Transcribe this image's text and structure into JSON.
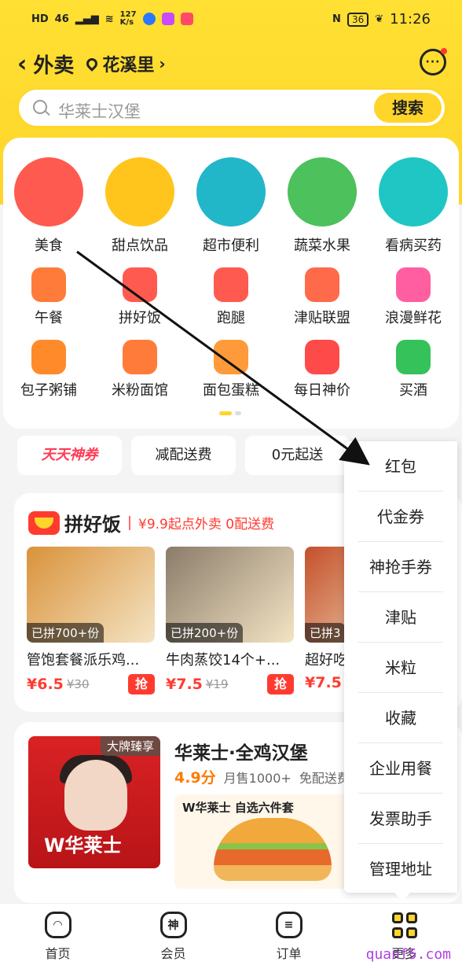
{
  "status_bar": {
    "left_text": "HD",
    "network": "46",
    "speed": "127\nK/s",
    "time": "11:26",
    "battery": "36"
  },
  "header": {
    "back_icon": "chevron-left-icon",
    "title": "外卖",
    "location": "花溪里",
    "message_icon": "chat-bubble-icon"
  },
  "search": {
    "placeholder": "华莱士汉堡",
    "button": "搜索"
  },
  "categories_main": [
    {
      "label": "美食",
      "icon": "food-icon",
      "color": "#ff5a4f"
    },
    {
      "label": "甜点饮品",
      "icon": "dessert-icon",
      "color": "#ffc51c"
    },
    {
      "label": "超市便利",
      "icon": "basket-icon",
      "color": "#22b6c9"
    },
    {
      "label": "蔬菜水果",
      "icon": "carrot-icon",
      "color": "#4cc15c"
    },
    {
      "label": "看病买药",
      "icon": "medicine-box-icon",
      "color": "#1fc6c4"
    }
  ],
  "categories_row2": [
    {
      "label": "午餐",
      "icon": "rice-bowl-icon",
      "color": "#ff7b3a"
    },
    {
      "label": "拼好饭",
      "icon": "pinhaofan-icon",
      "color": "#ff5a4f"
    },
    {
      "label": "跑腿",
      "icon": "runner-icon",
      "color": "#ff5a4f"
    },
    {
      "label": "津贴联盟",
      "icon": "money-bag-icon",
      "color": "#ff6a4a"
    },
    {
      "label": "浪漫鲜花",
      "icon": "flower-icon",
      "color": "#ff5fa0"
    }
  ],
  "categories_row3": [
    {
      "label": "包子粥铺",
      "icon": "bun-icon",
      "color": "#ff8a2a"
    },
    {
      "label": "米粉面馆",
      "icon": "noodle-icon",
      "color": "#ff7b3a"
    },
    {
      "label": "面包蛋糕",
      "icon": "donut-icon",
      "color": "#ff9a3a"
    },
    {
      "label": "每日神价",
      "icon": "lightning-icon",
      "color": "#ff4a4a"
    },
    {
      "label": "买酒",
      "icon": "bottle-icon",
      "color": "#36c25a"
    }
  ],
  "tabs": [
    "天天神券",
    "减配送费",
    "0元起送"
  ],
  "pinhaofan": {
    "name": "拼好饭",
    "slogan": "¥9.9起点外卖 0配送费",
    "products": [
      {
        "tag": "已拼700+份",
        "name": "管饱套餐派乐鸡...",
        "price": "¥6.5",
        "orig": "¥30",
        "grab": "抢",
        "color": "#d9923a"
      },
      {
        "tag": "已拼200+份",
        "name": "牛肉蒸饺14个+...",
        "price": "¥7.5",
        "orig": "¥19",
        "grab": "抢",
        "color": "#8a7c6a"
      },
      {
        "tag": "已拼3",
        "name": "超好吃",
        "price": "¥7.5",
        "orig": "",
        "grab": "",
        "color": "#c4502a"
      }
    ]
  },
  "store": {
    "badge": "大牌臻享",
    "brand": "W华莱士",
    "name": "华莱士·全鸡汉堡",
    "score": "4.9分",
    "sales": "月售1000+",
    "delivery": "免配送费",
    "banner_title": "W华莱士  自选六件套"
  },
  "dropdown_menu": [
    "红包",
    "代金券",
    "神抢手券",
    "津贴",
    "米粒",
    "收藏",
    "企业用餐",
    "发票助手",
    "管理地址"
  ],
  "bottom_nav": [
    {
      "label": "首页",
      "icon": "home-icon"
    },
    {
      "label": "会员",
      "icon": "member-icon"
    },
    {
      "label": "订单",
      "icon": "order-icon"
    },
    {
      "label": "更多",
      "icon": "grid-more-icon"
    }
  ],
  "watermark": "quanf5.com",
  "colors": {
    "brand_yellow": "#ffd52a",
    "accent_red": "#ff3b30"
  }
}
